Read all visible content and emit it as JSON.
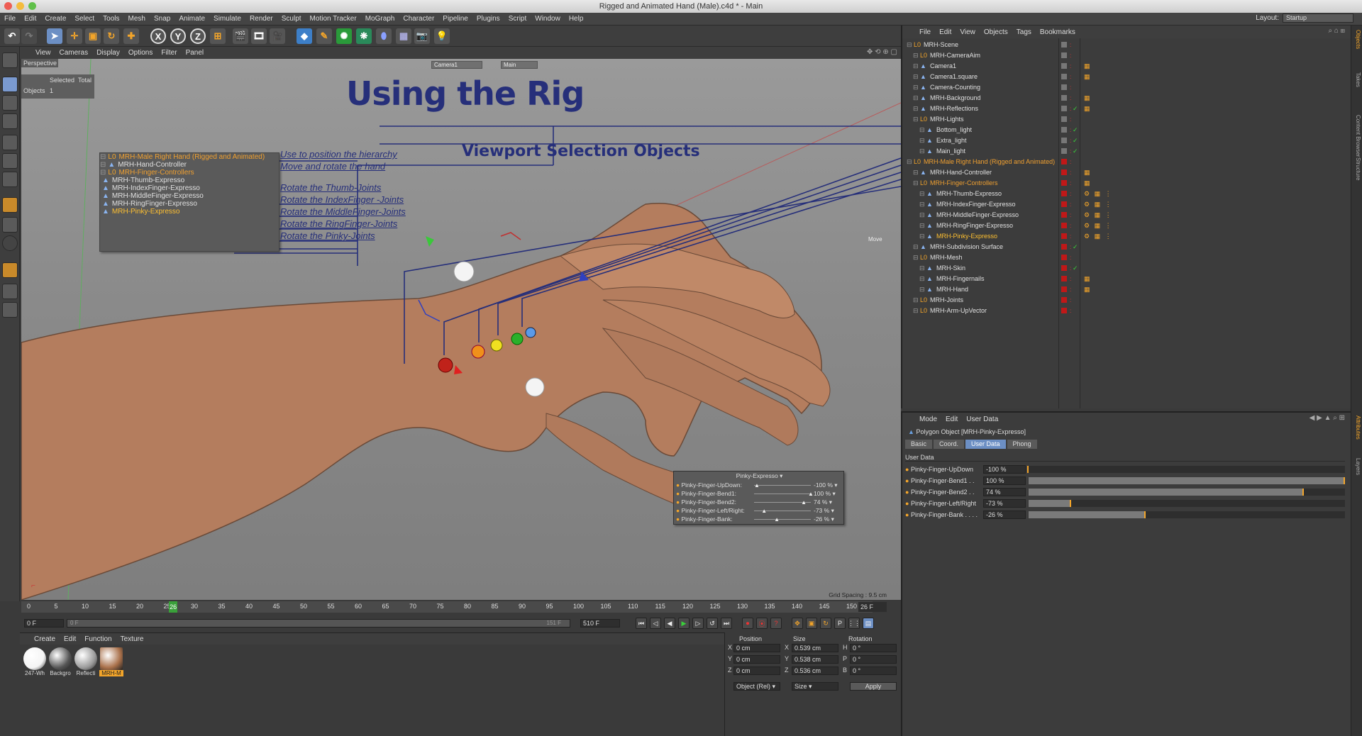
{
  "window": {
    "title": "Rigged and Animated Hand (Male).c4d * - Main"
  },
  "menubar": [
    "File",
    "Edit",
    "Create",
    "Select",
    "Tools",
    "Mesh",
    "Snap",
    "Animate",
    "Simulate",
    "Render",
    "Sculpt",
    "Motion Tracker",
    "MoGraph",
    "Character",
    "Pipeline",
    "Plugins",
    "Script",
    "Window",
    "Help"
  ],
  "layout": {
    "label": "Layout:",
    "value": "Startup"
  },
  "toolbar": {
    "axis_x": "X",
    "axis_y": "Y",
    "axis_z": "Z"
  },
  "viewport": {
    "menu": [
      "View",
      "Cameras",
      "Display",
      "Options",
      "Filter",
      "Panel"
    ],
    "name": "Perspective",
    "camera_box": "Camera1",
    "main_box": "Main",
    "stats": {
      "selected": "Selected",
      "total": "Total",
      "objects_label": "Objects",
      "objects_value": "1"
    },
    "title": "Using the Rig",
    "subtitle": "Viewport Selection Objects",
    "move_label": "Move",
    "grid_spacing": "Grid Spacing : 9.5 cm",
    "hierarchy": [
      {
        "label": "MRH-Male Right Hand (Rigged and Animated)",
        "color": "#f0a030"
      },
      {
        "label": "MRH-Hand-Controller",
        "color": "#e0e0e0"
      },
      {
        "label": "MRH-Finger-Controllers",
        "color": "#f0a030"
      },
      {
        "label": "MRH-Thumb-Expresso",
        "color": "#e0e0e0"
      },
      {
        "label": "MRH-IndexFinger-Expresso",
        "color": "#e0e0e0"
      },
      {
        "label": "MRH-MiddleFinger-Expresso",
        "color": "#e0e0e0"
      },
      {
        "label": "MRH-RingFinger-Expresso",
        "color": "#e0e0e0"
      },
      {
        "label": "MRH-Pinky-Expresso",
        "color": "#ffc030"
      }
    ],
    "annotations": [
      "Use to position the hierarchy",
      "Move and rotate the hand",
      "Rotate the Thumb-Joints",
      "Rotate the IndexFinger -Joints",
      "Rotate the MiddleFinger-Joints",
      "Rotate the RingFinger-Joints",
      "Rotate the Pinky-Joints"
    ],
    "xpresso_panel": {
      "title": "Pinky-Expresso",
      "rows": [
        {
          "label": "Pinky-Finger-UpDown:",
          "value": "-100 %",
          "level": 0.0
        },
        {
          "label": "Pinky-Finger-Bend1:",
          "value": "100 %",
          "level": 1.0
        },
        {
          "label": "Pinky-Finger-Bend2:",
          "value": "74 %",
          "level": 0.87
        },
        {
          "label": "Pinky-Finger-Left/Right:",
          "value": "-73 %",
          "level": 0.135
        },
        {
          "label": "Pinky-Finger-Bank:",
          "value": "-26 %",
          "level": 0.37
        }
      ]
    }
  },
  "timeline": {
    "ticks": [
      "0",
      "5",
      "10",
      "15",
      "20",
      "25",
      "26",
      "30",
      "35",
      "40",
      "45",
      "50",
      "55",
      "60",
      "65",
      "70",
      "75",
      "80",
      "85",
      "90",
      "95",
      "100",
      "105",
      "110",
      "115",
      "120",
      "125",
      "130",
      "135",
      "140",
      "145",
      "150"
    ],
    "current_frame": "26 F",
    "start_field": "0 F",
    "range_start": "0 F",
    "range_end": "151 F",
    "end_field": "510 F"
  },
  "material_manager": {
    "menu": [
      "Create",
      "Edit",
      "Function",
      "Texture"
    ],
    "materials": [
      {
        "name": "247-Wh",
        "color": "#f4f4f4"
      },
      {
        "name": "Backgro",
        "color": "#555555"
      },
      {
        "name": "Reflecti",
        "color": "#9a9a9a"
      },
      {
        "name": "MRH-M",
        "color": "#a9704a"
      }
    ]
  },
  "coordinates": {
    "headers": [
      "Position",
      "Size",
      "Rotation"
    ],
    "rows": [
      {
        "axis": "X",
        "pos": "0 cm",
        "saxis": "X",
        "size": "0.539 cm",
        "raxis": "H",
        "rot": "0 °"
      },
      {
        "axis": "Y",
        "pos": "0 cm",
        "saxis": "Y",
        "size": "0.538 cm",
        "raxis": "P",
        "rot": "0 °"
      },
      {
        "axis": "Z",
        "pos": "0 cm",
        "saxis": "Z",
        "size": "0.536 cm",
        "raxis": "B",
        "rot": "0 °"
      }
    ],
    "mode_select": "Object (Rel)",
    "size_select": "Size",
    "apply": "Apply"
  },
  "object_manager": {
    "menu": [
      "File",
      "Edit",
      "View",
      "Objects",
      "Tags",
      "Bookmarks"
    ],
    "objects": [
      {
        "label": "MRH-Scene",
        "indent": 0,
        "color": "#e0e0e0"
      },
      {
        "label": "MRH-CameraAim",
        "indent": 1,
        "color": "#e0e0e0"
      },
      {
        "label": "Camera1",
        "indent": 1,
        "color": "#e0e0e0"
      },
      {
        "label": "Camera1.square",
        "indent": 1,
        "color": "#e0e0e0"
      },
      {
        "label": "Camera-Counting",
        "indent": 1,
        "color": "#e0e0e0"
      },
      {
        "label": "MRH-Background",
        "indent": 1,
        "color": "#e0e0e0"
      },
      {
        "label": "MRH-Reflections",
        "indent": 1,
        "color": "#e0e0e0"
      },
      {
        "label": "MRH-Lights",
        "indent": 1,
        "color": "#e0e0e0"
      },
      {
        "label": "Bottom_light",
        "indent": 2,
        "color": "#e0e0e0"
      },
      {
        "label": "Extra_light",
        "indent": 2,
        "color": "#e0e0e0"
      },
      {
        "label": "Main_light",
        "indent": 2,
        "color": "#e0e0e0"
      },
      {
        "label": "MRH-Male Right Hand (Rigged and Animated)",
        "indent": 0,
        "color": "#f0a030"
      },
      {
        "label": "MRH-Hand-Controller",
        "indent": 1,
        "color": "#e0e0e0"
      },
      {
        "label": "MRH-Finger-Controllers",
        "indent": 1,
        "color": "#f0a030"
      },
      {
        "label": "MRH-Thumb-Expresso",
        "indent": 2,
        "color": "#e0e0e0"
      },
      {
        "label": "MRH-IndexFinger-Expresso",
        "indent": 2,
        "color": "#e0e0e0"
      },
      {
        "label": "MRH-MiddleFinger-Expresso",
        "indent": 2,
        "color": "#e0e0e0"
      },
      {
        "label": "MRH-RingFinger-Expresso",
        "indent": 2,
        "color": "#e0e0e0"
      },
      {
        "label": "MRH-Pinky-Expresso",
        "indent": 2,
        "color": "#ffc030"
      },
      {
        "label": "MRH-Subdivision Surface",
        "indent": 1,
        "color": "#e0e0e0"
      },
      {
        "label": "MRH-Mesh",
        "indent": 1,
        "color": "#e0e0e0"
      },
      {
        "label": "MRH-Skin",
        "indent": 2,
        "color": "#e0e0e0"
      },
      {
        "label": "MRH-Fingernails",
        "indent": 2,
        "color": "#e0e0e0"
      },
      {
        "label": "MRH-Hand",
        "indent": 2,
        "color": "#e0e0e0"
      },
      {
        "label": "MRH-Joints",
        "indent": 1,
        "color": "#e0e0e0"
      },
      {
        "label": "MRH-Arm-UpVector",
        "indent": 1,
        "color": "#e0e0e0"
      }
    ]
  },
  "attribute_manager": {
    "menu": [
      "Mode",
      "Edit",
      "User Data"
    ],
    "object_title": "Polygon Object [MRH-Pinky-Expresso]",
    "tabs": [
      "Basic",
      "Coord.",
      "User Data",
      "Phong"
    ],
    "active_tab": "User Data",
    "section": "User Data",
    "rows": [
      {
        "label": "Pinky-Finger-UpDown",
        "value": "-100 %",
        "level": 0.0
      },
      {
        "label": "Pinky-Finger-Bend1 . .",
        "value": "100 %",
        "level": 1.0
      },
      {
        "label": "Pinky-Finger-Bend2 . .",
        "value": "74 %",
        "level": 0.87
      },
      {
        "label": "Pinky-Finger-Left/Right",
        "value": "-73 %",
        "level": 0.135
      },
      {
        "label": "Pinky-Finger-Bank . . . .",
        "value": "-26 %",
        "level": 0.37
      }
    ]
  },
  "right_strip": [
    "Objects",
    "Takes",
    "Content Browser",
    "Structure"
  ],
  "right_strip_lower": [
    "Attributes",
    "Layers"
  ]
}
